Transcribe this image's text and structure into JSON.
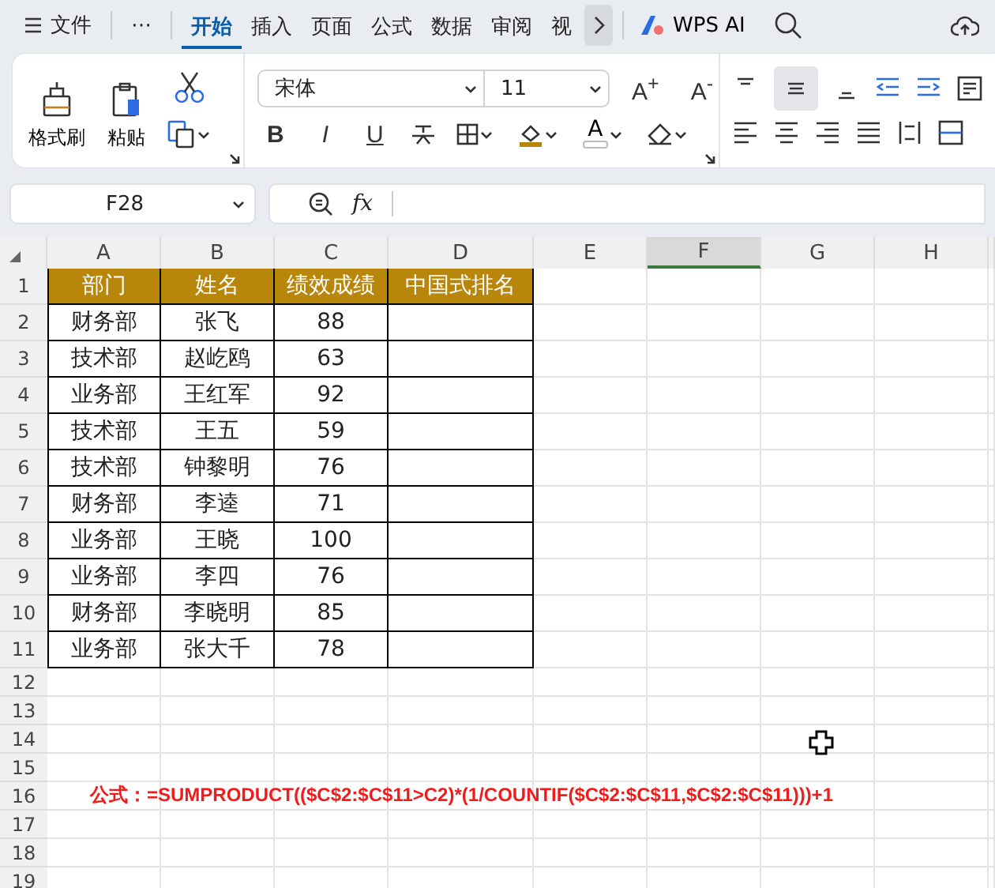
{
  "top_bar": {
    "file_menu": "文件",
    "more": "⋯",
    "tabs": [
      {
        "label": "开始",
        "selected": true
      },
      {
        "label": "插入",
        "selected": false
      },
      {
        "label": "页面",
        "selected": false
      },
      {
        "label": "公式",
        "selected": false
      },
      {
        "label": "数据",
        "selected": false
      },
      {
        "label": "审阅",
        "selected": false
      },
      {
        "label": "视",
        "selected": false
      }
    ],
    "ai_button": "WPS AI"
  },
  "ribbon": {
    "format_painter": "格式刷",
    "paste": "粘贴",
    "font_name": "宋体",
    "font_size": "11",
    "grow_font": "A$^{+}$",
    "shrink_font": "A$^{-}$",
    "bold": "B",
    "italic": "I",
    "underline": "U",
    "font_color": "A"
  },
  "formula_bar": {
    "name_box": "F28",
    "fx": "fx"
  },
  "sheet": {
    "columns": [
      {
        "label": "A",
        "selected": false
      },
      {
        "label": "B",
        "selected": false
      },
      {
        "label": "C",
        "selected": false
      },
      {
        "label": "D",
        "selected": false
      },
      {
        "label": "E",
        "selected": false
      },
      {
        "label": "F",
        "selected": true
      },
      {
        "label": "G",
        "selected": false
      },
      {
        "label": "H",
        "selected": false
      }
    ],
    "rows": [
      {
        "number": "1",
        "kind": "header",
        "cells": [
          "部门",
          "姓名",
          "绩效成绩",
          "中国式排名"
        ]
      },
      {
        "number": "2",
        "kind": "data",
        "cells": [
          "财务部",
          "张飞",
          "88"
        ]
      },
      {
        "number": "3",
        "kind": "data",
        "cells": [
          "技术部",
          "赵屹鸥",
          "63"
        ]
      },
      {
        "number": "4",
        "kind": "data",
        "cells": [
          "业务部",
          "王红军",
          "92"
        ]
      },
      {
        "number": "5",
        "kind": "data",
        "cells": [
          "技术部",
          "王五",
          "59"
        ]
      },
      {
        "number": "6",
        "kind": "data",
        "cells": [
          "技术部",
          "钟黎明",
          "76"
        ]
      },
      {
        "number": "7",
        "kind": "data",
        "cells": [
          "财务部",
          "李逵",
          "71"
        ]
      },
      {
        "number": "8",
        "kind": "data",
        "cells": [
          "业务部",
          "王晓",
          "100"
        ]
      },
      {
        "number": "9",
        "kind": "data",
        "cells": [
          "业务部",
          "李四",
          "76"
        ]
      },
      {
        "number": "10",
        "kind": "data",
        "cells": [
          "财务部",
          "李晓明",
          "85"
        ]
      },
      {
        "number": "11",
        "kind": "data",
        "cells": [
          "业务部",
          "张大千",
          "78"
        ]
      },
      {
        "number": "12",
        "kind": "empty"
      },
      {
        "number": "13",
        "kind": "empty"
      },
      {
        "number": "14",
        "kind": "empty"
      },
      {
        "number": "15",
        "kind": "empty"
      },
      {
        "number": "16",
        "kind": "note",
        "cells": [
          "公式：=SUMPRODUCT(($C$2:$C$11>C2)*(1/COUNTIF($C$2:$C$11,$C$2:$C$11)))+1"
        ]
      },
      {
        "number": "17",
        "kind": "empty"
      },
      {
        "number": "18",
        "kind": "empty"
      },
      {
        "number": "19",
        "kind": "empty"
      }
    ]
  }
}
